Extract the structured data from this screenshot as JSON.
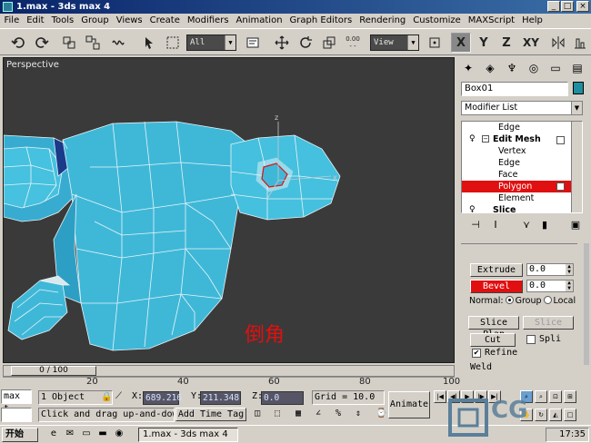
{
  "window": {
    "title": "1.max - 3ds max 4"
  },
  "menu": [
    "File",
    "Edit",
    "Tools",
    "Group",
    "Views",
    "Create",
    "Modifiers",
    "Animation",
    "Graph Editors",
    "Rendering",
    "Customize",
    "MAXScript",
    "Help"
  ],
  "toolbar": {
    "selection_filter": "All",
    "coord_system": "View",
    "axis": [
      "X",
      "Y",
      "Z",
      "XY"
    ],
    "active_axis": "X"
  },
  "viewport": {
    "label": "Perspective",
    "annotation": "倒角",
    "model_color": "#3fb8d8"
  },
  "command_panel": {
    "object_name": "Box01",
    "object_color": "#1e8fa0",
    "modifier_list": "Modifier List",
    "stack": [
      {
        "label": "Edge",
        "level": 2
      },
      {
        "label": "Edit Mesh",
        "level": 0
      },
      {
        "label": "Vertex",
        "level": 2
      },
      {
        "label": "Edge",
        "level": 2
      },
      {
        "label": "Face",
        "level": 2
      },
      {
        "label": "Polygon",
        "level": 2,
        "selected": true
      },
      {
        "label": "Element",
        "level": 2
      },
      {
        "label": "Slice",
        "level": 0
      }
    ],
    "rollout": {
      "extrude_label": "Extrude",
      "extrude_value": "0.0",
      "bevel_label": "Bevel",
      "bevel_value": "0.0",
      "normal_label": "Normal:",
      "normal_options": [
        "Group",
        "Local"
      ],
      "normal_selected": "Group",
      "slice_plane": "Slice Plan",
      "slice": "Slice",
      "cut": "Cut",
      "split": "Spli",
      "refine": "Refine",
      "refine_checked": true,
      "weld": "Weld"
    }
  },
  "timeline": {
    "frame_display": "0 / 100",
    "ticks": [
      "20",
      "40",
      "60",
      "80",
      "100"
    ]
  },
  "status": {
    "max_label": "max t",
    "objects": "1 Object",
    "x_label": "X:",
    "x_value": "689.216",
    "y_label": "Y:",
    "y_value": "211.348",
    "z_label": "Z:",
    "z_value": "0.0",
    "grid": "Grid = 10.0",
    "animate": "Animate",
    "prompt": "Click and drag up-and-dow",
    "add_time_tag": "Add Time Tag"
  },
  "taskbar": {
    "start": "开始",
    "task": "1.max - 3ds max 4",
    "clock": "17:35"
  },
  "watermark": "CG"
}
